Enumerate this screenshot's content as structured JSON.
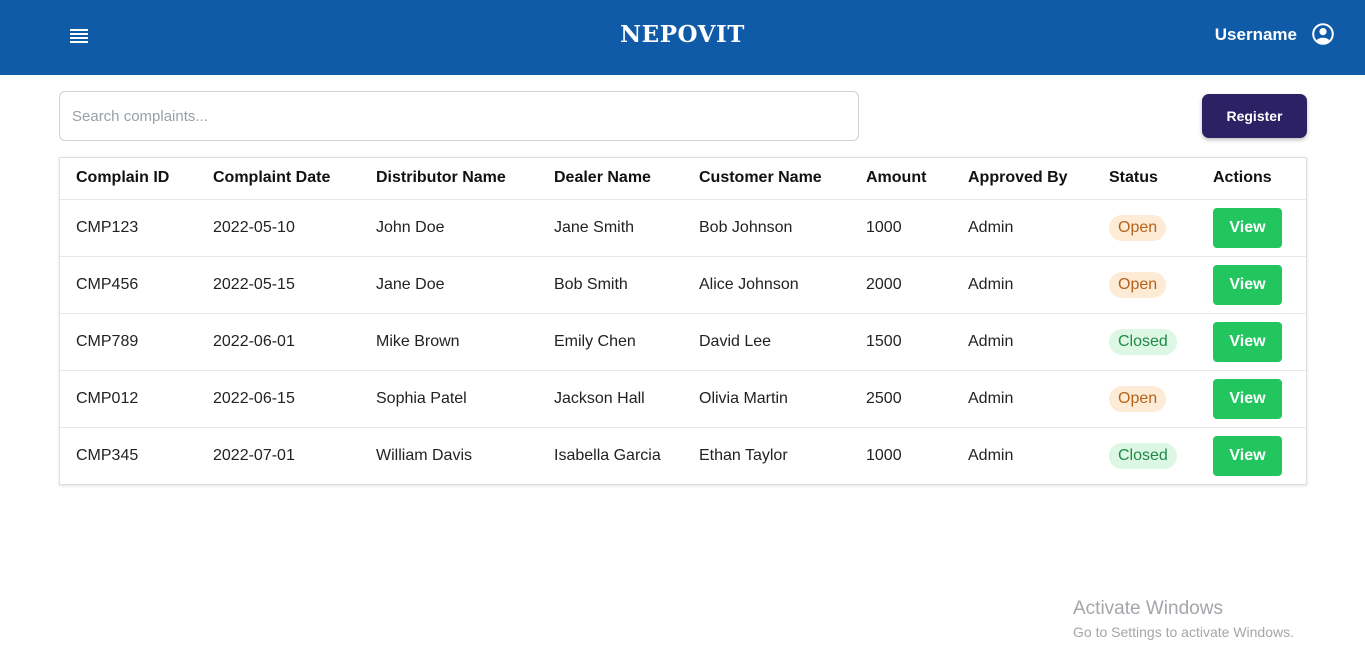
{
  "header": {
    "brand": "NEPOVIT",
    "username": "Username",
    "icons": {
      "menu": "hamburger-menu-icon",
      "user": "user-circle-icon"
    },
    "colors": {
      "bar": "#0f5ba8"
    }
  },
  "toolbar": {
    "search_placeholder": "Search complaints...",
    "register_label": "Register"
  },
  "table": {
    "columns": [
      "Complain ID",
      "Complaint Date",
      "Distributor Name",
      "Dealer Name",
      "Customer Name",
      "Amount",
      "Approved By",
      "Status",
      "Actions"
    ],
    "rows": [
      {
        "id": "CMP123",
        "date": "2022-05-10",
        "distributor": "John Doe",
        "dealer": "Jane Smith",
        "customer": "Bob Johnson",
        "amount": "1000",
        "approved_by": "Admin",
        "status": "Open",
        "action": "View"
      },
      {
        "id": "CMP456",
        "date": "2022-05-15",
        "distributor": "Jane Doe",
        "dealer": "Bob Smith",
        "customer": "Alice Johnson",
        "amount": "2000",
        "approved_by": "Admin",
        "status": "Open",
        "action": "View"
      },
      {
        "id": "CMP789",
        "date": "2022-06-01",
        "distributor": "Mike Brown",
        "dealer": "Emily Chen",
        "customer": "David Lee",
        "amount": "1500",
        "approved_by": "Admin",
        "status": "Closed",
        "action": "View"
      },
      {
        "id": "CMP012",
        "date": "2022-06-15",
        "distributor": "Sophia Patel",
        "dealer": "Jackson Hall",
        "customer": "Olivia Martin",
        "amount": "2500",
        "approved_by": "Admin",
        "status": "Open",
        "action": "View"
      },
      {
        "id": "CMP345",
        "date": "2022-07-01",
        "distributor": "William Davis",
        "dealer": "Isabella Garcia",
        "customer": "Ethan Taylor",
        "amount": "1000",
        "approved_by": "Admin",
        "status": "Closed",
        "action": "View"
      }
    ]
  },
  "watermark": {
    "title": "Activate Windows",
    "subtitle": "Go to Settings to activate Windows."
  }
}
